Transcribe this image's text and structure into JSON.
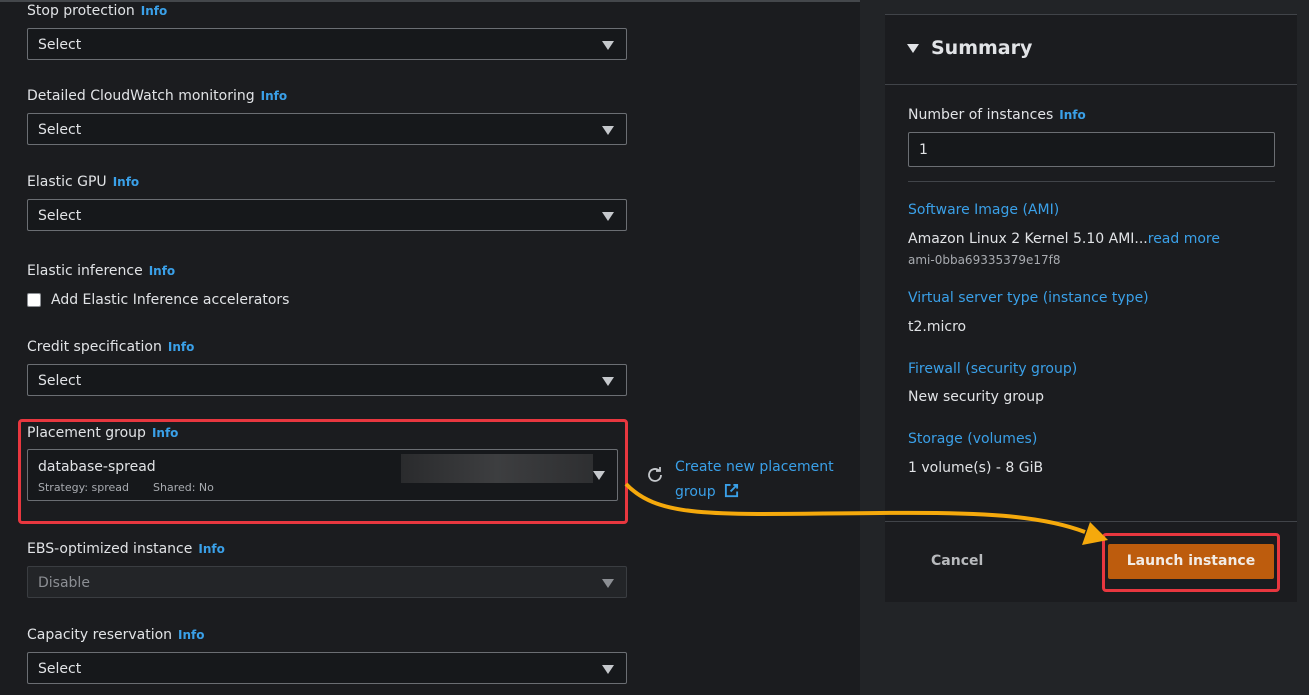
{
  "left": {
    "info_label": "Info",
    "fields": [
      {
        "label": "Stop protection",
        "value": "Select"
      },
      {
        "label": "Detailed CloudWatch monitoring",
        "value": "Select"
      },
      {
        "label": "Elastic GPU",
        "value": "Select"
      },
      {
        "label": "Elastic inference",
        "checkbox_label": "Add Elastic Inference accelerators",
        "checked": false
      },
      {
        "label": "Credit specification",
        "value": "Select"
      },
      {
        "label": "Placement group",
        "value": "database-spread",
        "strategy": "Strategy: spread",
        "shared": "Shared: No"
      },
      {
        "label": "EBS-optimized instance",
        "value": "Disable",
        "disabled": true
      },
      {
        "label": "Capacity reservation",
        "value": "Select"
      }
    ],
    "create_placement_link_line1": "Create new placement",
    "create_placement_link_line2": "group"
  },
  "summary": {
    "title": "Summary",
    "instances_label": "Number of instances",
    "info_label": "Info",
    "instances_value": "1",
    "ami_heading": "Software Image (AMI)",
    "ami_value": "Amazon Linux 2 Kernel 5.10 AMI...",
    "ami_read_more": "read more",
    "ami_id": "ami-0bba69335379e17f8",
    "instance_type_heading": "Virtual server type (instance type)",
    "instance_type_value": "t2.micro",
    "firewall_heading": "Firewall (security group)",
    "firewall_value": "New security group",
    "storage_heading": "Storage (volumes)",
    "storage_value": "1 volume(s) - 8 GiB",
    "cancel_label": "Cancel",
    "launch_label": "Launch instance"
  },
  "colors": {
    "accent_link": "#3aa0e8",
    "launch_button": "#bd5c0d",
    "highlight": "#e8373f",
    "arrow": "#f5a90c"
  }
}
